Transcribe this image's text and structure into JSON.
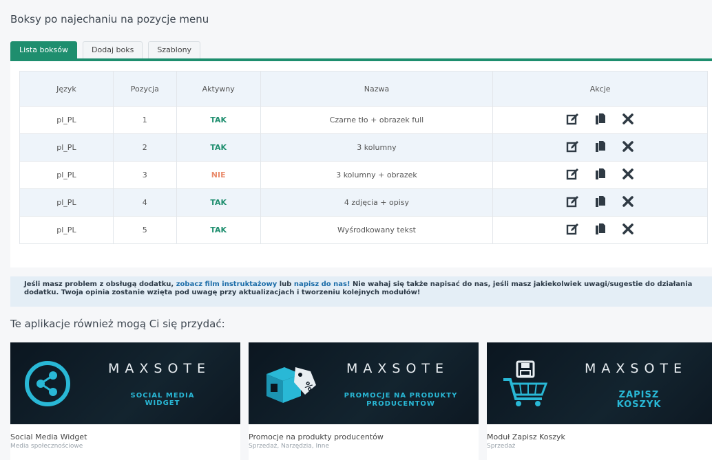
{
  "page": {
    "title": "Boksy po najechaniu na pozycje menu"
  },
  "tabs": [
    {
      "label": "Lista boksów",
      "active": true
    },
    {
      "label": "Dodaj boks",
      "active": false
    },
    {
      "label": "Szablony",
      "active": false
    }
  ],
  "table": {
    "headers": [
      "Język",
      "Pozycja",
      "Aktywny",
      "Nazwa",
      "Akcje"
    ],
    "rows": [
      {
        "lang": "pl_PL",
        "pos": "1",
        "active": "TAK",
        "name": "Czarne tło + obrazek full"
      },
      {
        "lang": "pl_PL",
        "pos": "2",
        "active": "TAK",
        "name": "3 kolumny"
      },
      {
        "lang": "pl_PL",
        "pos": "3",
        "active": "NIE",
        "name": "3 kolumny + obrazek"
      },
      {
        "lang": "pl_PL",
        "pos": "4",
        "active": "TAK",
        "name": "4 zdjęcia + opisy"
      },
      {
        "lang": "pl_PL",
        "pos": "5",
        "active": "TAK",
        "name": "Wyśrodkowany tekst"
      }
    ],
    "action_icons": [
      "edit-icon",
      "copy-icon",
      "delete-icon"
    ]
  },
  "info": {
    "part1": "Jeśli masz problem z obsługą dodatku, ",
    "link1": "zobacz film instruktażowy",
    "part2": " lub ",
    "link2": "napisz do nas!",
    "part3": " Nie wahaj się także napisać do nas, jeśli masz jakiekolwiek uwagi/sugestie do działania dodatku. Twoja opinia zostanie wzięta pod uwagę przy aktualizacjach i tworzeniu kolejnych modułów!"
  },
  "apps": {
    "title": "Te aplikacje również mogą Ci się przydać:",
    "cards": [
      {
        "brand": "MAXSOTE",
        "banner_line1": "SOCIAL MEDIA",
        "banner_line2": "WIDGET",
        "name": "Social Media Widget",
        "category": "Media społecznościowe",
        "icon": "share-icon"
      },
      {
        "brand": "MAXSOTE",
        "banner_line1": "PROMOCJE NA PRODUKTY",
        "banner_line2": "PRODUCENTÓW",
        "name": "Promocje na produkty producentów",
        "category": "Sprzedaż, Narzędzia, Inne",
        "icon": "box-discount-icon"
      },
      {
        "brand": "MAXSOTE",
        "banner_line1": "ZAPISZ",
        "banner_line2": "KOSZYK",
        "name": "Moduł Zapisz Koszyk",
        "category": "Sprzedaż",
        "icon": "save-cart-icon"
      }
    ]
  },
  "colors": {
    "accent": "#1e8e6e",
    "active_yes": "#1e8e6e",
    "active_no": "#e98b6c",
    "link": "#1b6ca8",
    "banner_text": "#29b8d6"
  }
}
